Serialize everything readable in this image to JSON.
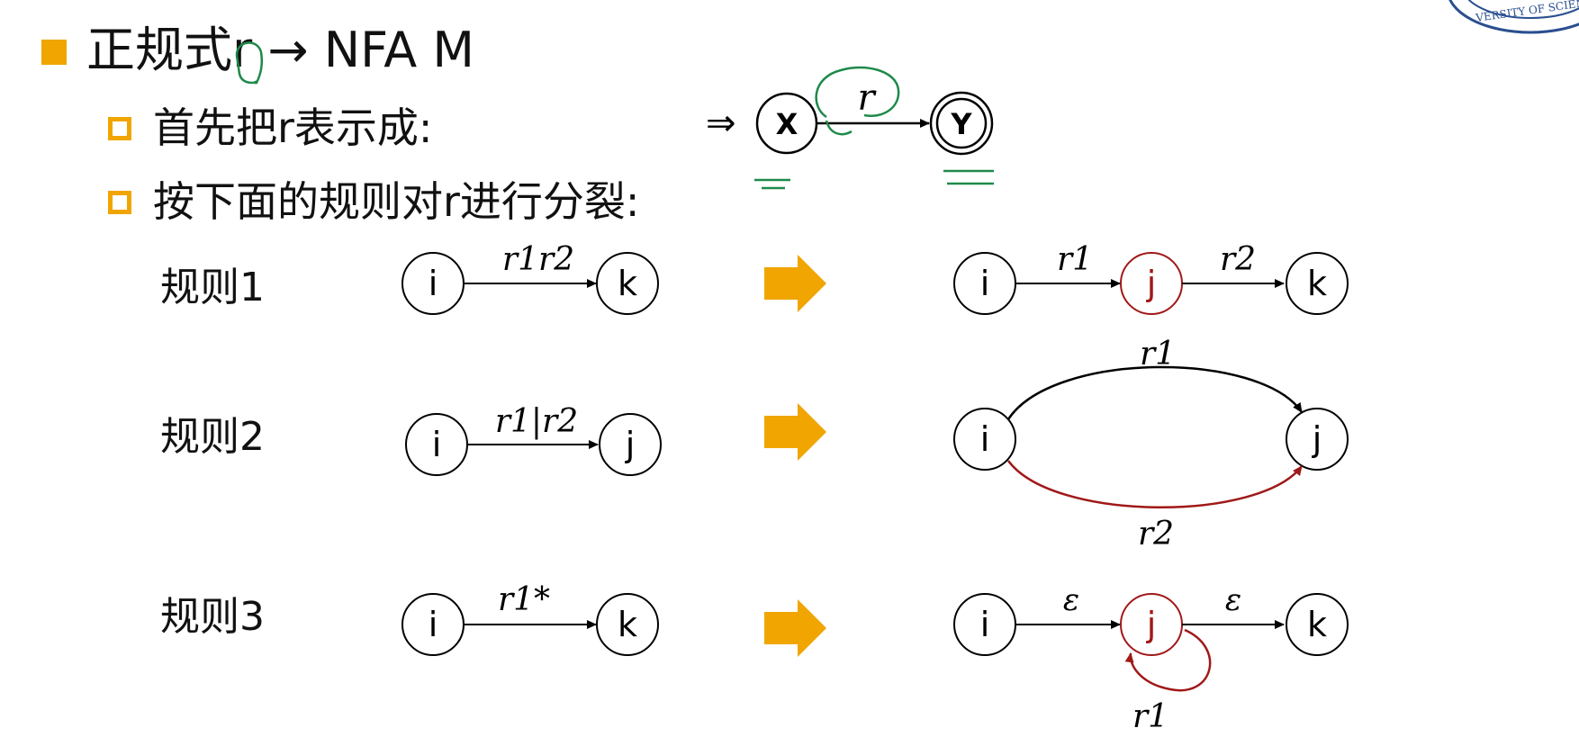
{
  "heading": {
    "text": "正规式r → NFA M"
  },
  "steps": [
    {
      "text": "首先把r表示成:"
    },
    {
      "text": "按下面的规则对r进行分裂:"
    }
  ],
  "start_diagram": {
    "arrow": "⇒",
    "start_state": "X",
    "final_state": "Y",
    "edge_label": "r"
  },
  "rules": [
    {
      "name": "规则1",
      "left": {
        "from": "i",
        "to": "k",
        "label": "r1r2"
      },
      "right": {
        "nodes": [
          "i",
          "j",
          "k"
        ],
        "labels": [
          "r1",
          "r2"
        ]
      }
    },
    {
      "name": "规则2",
      "left": {
        "from": "i",
        "to": "j",
        "label": "r1|r2"
      },
      "right": {
        "nodes": [
          "i",
          "j"
        ],
        "labels": [
          "r1",
          "r2"
        ]
      }
    },
    {
      "name": "规则3",
      "left": {
        "from": "i",
        "to": "k",
        "label": "r1*"
      },
      "right": {
        "nodes": [
          "i",
          "j",
          "k"
        ],
        "labels": [
          "ε",
          "ε",
          "r1"
        ]
      }
    }
  ],
  "seal_text": "VERSITY OF SCIENC",
  "colors": {
    "accent": "#f0a500",
    "red_state": "#a01818",
    "annotation_green": "#1e8a4a",
    "seal_blue": "#2a4f8f"
  },
  "icons": {
    "bullet": "square",
    "transform_arrow": "right-arrow"
  }
}
